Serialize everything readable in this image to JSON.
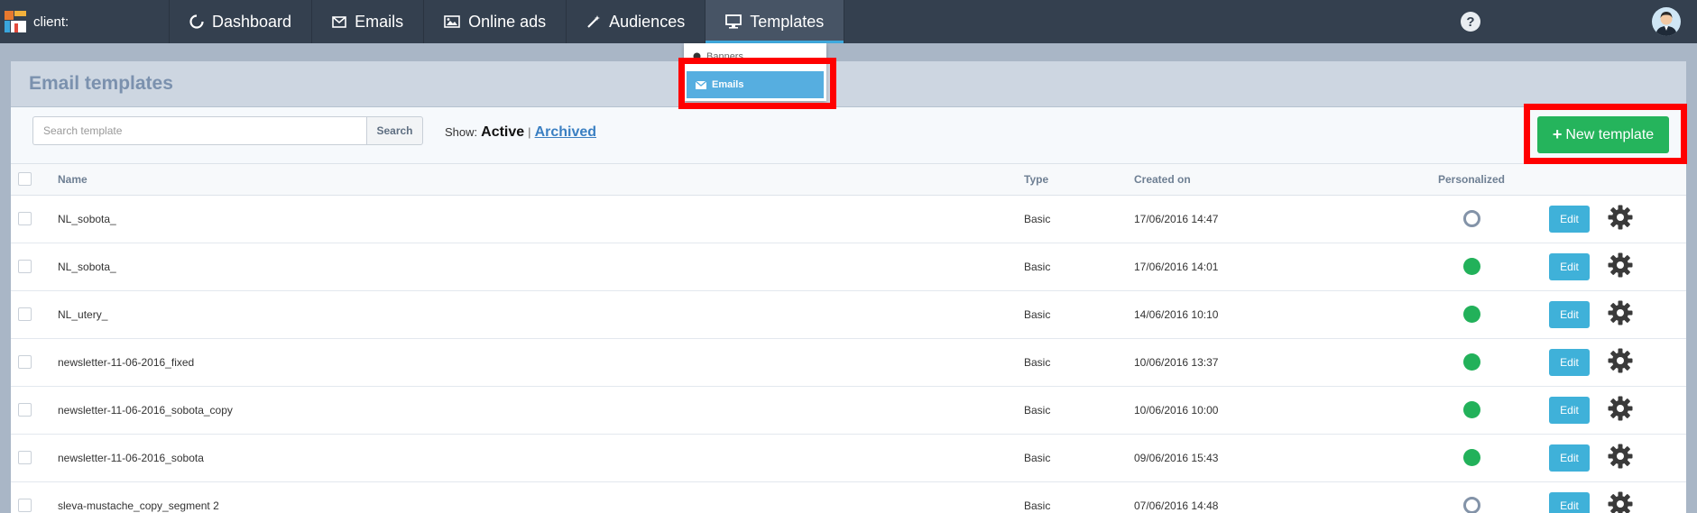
{
  "nav": {
    "client_label": "client:",
    "items": [
      {
        "label": "Dashboard",
        "icon": "loading-circle-icon"
      },
      {
        "label": "Emails",
        "icon": "envelope-icon"
      },
      {
        "label": "Online ads",
        "icon": "image-icon"
      },
      {
        "label": "Audiences",
        "icon": "magic-wand-icon"
      },
      {
        "label": "Templates",
        "icon": "monitor-icon"
      }
    ],
    "help": "?"
  },
  "dropdown": {
    "items": [
      {
        "label": "Banners",
        "icon": "dot-icon"
      },
      {
        "label": "Emails",
        "icon": "envelope-icon"
      }
    ]
  },
  "page": {
    "title": "Email templates"
  },
  "toolbar": {
    "search_placeholder": "Search template",
    "search_button": "Search",
    "show_label": "Show:",
    "active": "Active",
    "separator": "|",
    "archived": "Archived",
    "new_template_plus": "+",
    "new_template": "New template"
  },
  "table": {
    "headers": {
      "name": "Name",
      "type": "Type",
      "created": "Created on",
      "personalized": "Personalized"
    },
    "edit_label": "Edit",
    "rows": [
      {
        "name": "NL_sobota_",
        "type": "Basic",
        "created": "17/06/2016 14:47",
        "personalized": false
      },
      {
        "name": "NL_sobota_",
        "type": "Basic",
        "created": "17/06/2016 14:01",
        "personalized": true
      },
      {
        "name": "NL_utery_",
        "type": "Basic",
        "created": "14/06/2016 10:10",
        "personalized": true
      },
      {
        "name": "newsletter-11-06-2016_fixed",
        "type": "Basic",
        "created": "10/06/2016 13:37",
        "personalized": true
      },
      {
        "name": "newsletter-11-06-2016_sobota_copy",
        "type": "Basic",
        "created": "10/06/2016 10:00",
        "personalized": true
      },
      {
        "name": "newsletter-11-06-2016_sobota",
        "type": "Basic",
        "created": "09/06/2016 15:43",
        "personalized": true
      },
      {
        "name": "sleva-mustache_copy_segment 2",
        "type": "Basic",
        "created": "07/06/2016 14:48",
        "personalized": false
      }
    ]
  },
  "colors": {
    "nav_bg": "#34404f",
    "accent": "#3fa9dd",
    "green": "#25b45c",
    "edit": "#3fb1d9",
    "highlight": "#ff0000"
  }
}
